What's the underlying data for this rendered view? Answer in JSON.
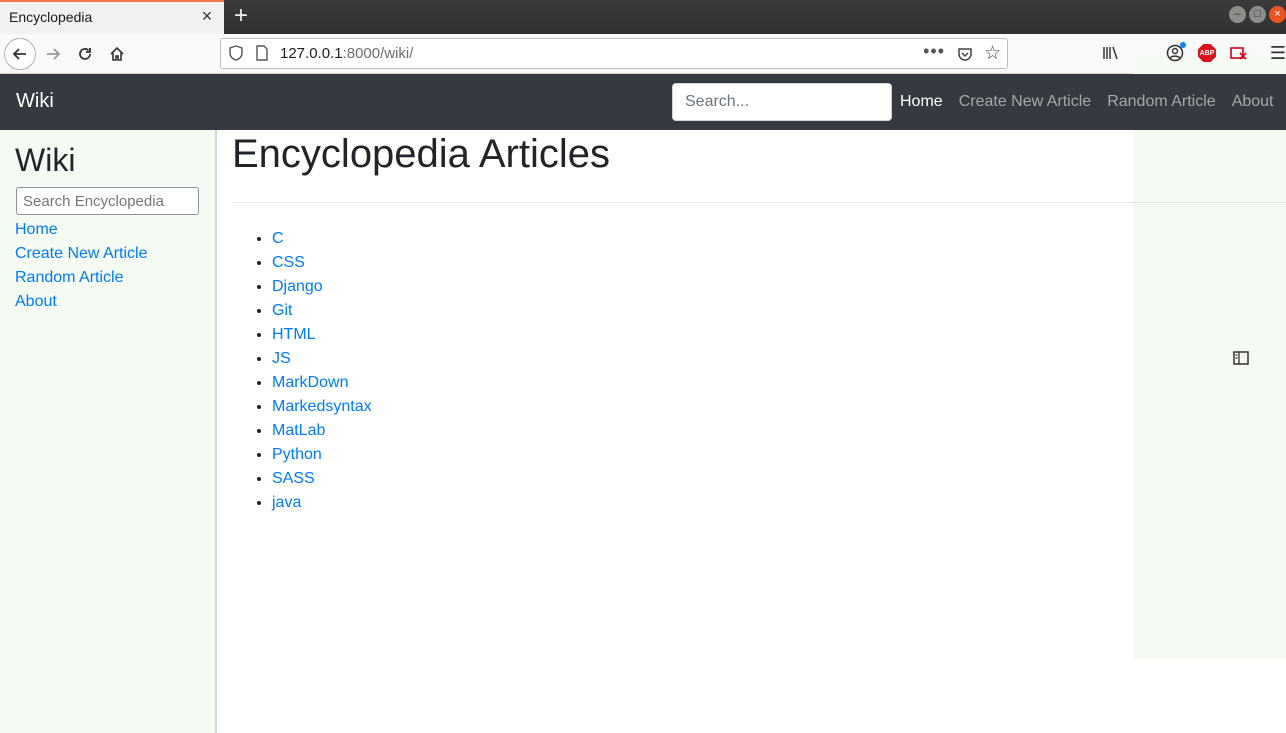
{
  "browser": {
    "tab_title": "Encyclopedia",
    "tab_close": "×",
    "new_tab": "+",
    "url_host": "127.0.0.1",
    "url_rest": ":8000/wiki/",
    "url_more": "•••",
    "abp_label": "ABP"
  },
  "navbar": {
    "brand": "Wiki",
    "search_placeholder": "Search...",
    "links": [
      "Home",
      "Create New Article",
      "Random Article",
      "About"
    ]
  },
  "sidebar": {
    "title": "Wiki",
    "search_placeholder": "Search Encyclopedia",
    "links": [
      "Home",
      "Create New Article",
      "Random Article",
      "About"
    ]
  },
  "main": {
    "heading": "Encyclopedia Articles",
    "articles": [
      "C",
      "CSS",
      "Django",
      "Git",
      "HTML",
      "JS",
      "MarkDown",
      "Markedsyntax",
      "MatLab",
      "Python",
      "SASS",
      "java"
    ]
  },
  "colors": {
    "navbar_bg": "#343a40",
    "link": "#007bff",
    "sidebar_bg": "#f5faf2",
    "tab_accent": "#f3744a"
  }
}
